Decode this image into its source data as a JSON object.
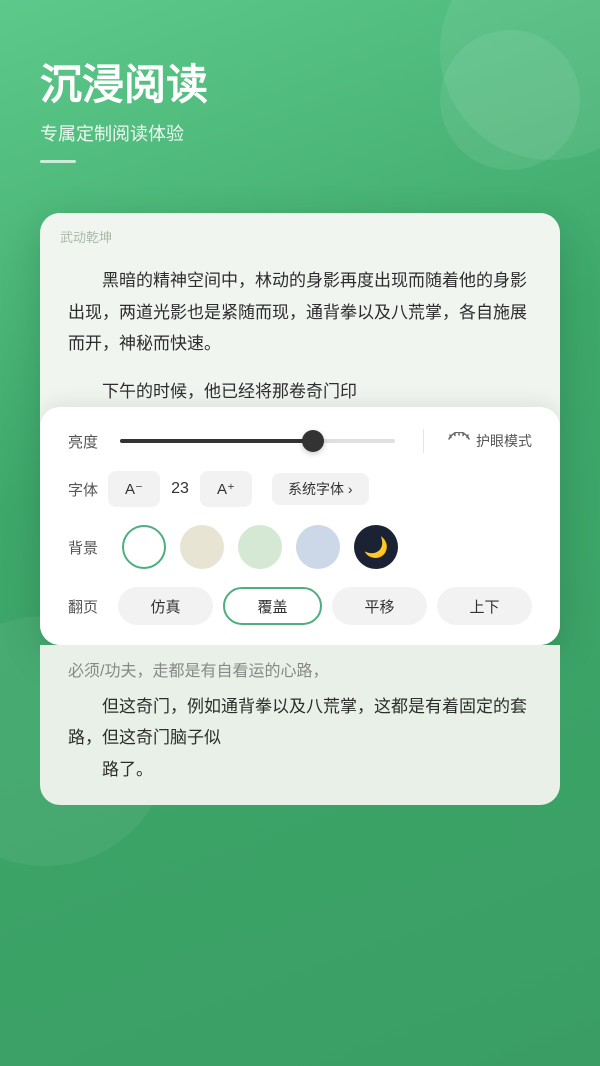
{
  "header": {
    "title": "沉浸阅读",
    "subtitle": "专属定制阅读体验"
  },
  "book": {
    "title": "武动乾坤",
    "paragraph1": "黑暗的精神空间中，林动的身影再度出现而随着他的身影出现，两道光影也是紧随而现，通背拳以及八荒掌，各自施展而开，神秘而快速。",
    "paragraph2": "下午的时候，他已经将那卷奇门印"
  },
  "settings": {
    "brightness_label": "亮度",
    "eye_mode_label": "护眼模式",
    "font_label": "字体",
    "font_decrease": "A⁻",
    "font_size": "23",
    "font_increase": "A⁺",
    "font_family": "系统字体 ›",
    "bg_label": "背景",
    "pageturn_label": "翻页",
    "pageturn_options": [
      "仿真",
      "覆盖",
      "平移",
      "上下"
    ],
    "pageturn_active": "覆盖"
  },
  "bottom": {
    "text1": "必须/功夫，走都是有自看运的心路，",
    "text2": "但这奇门，例如通背拳以及八荒掌，这都是有着固定的套路，但这奇门脑子似",
    "text3": "路了。"
  }
}
